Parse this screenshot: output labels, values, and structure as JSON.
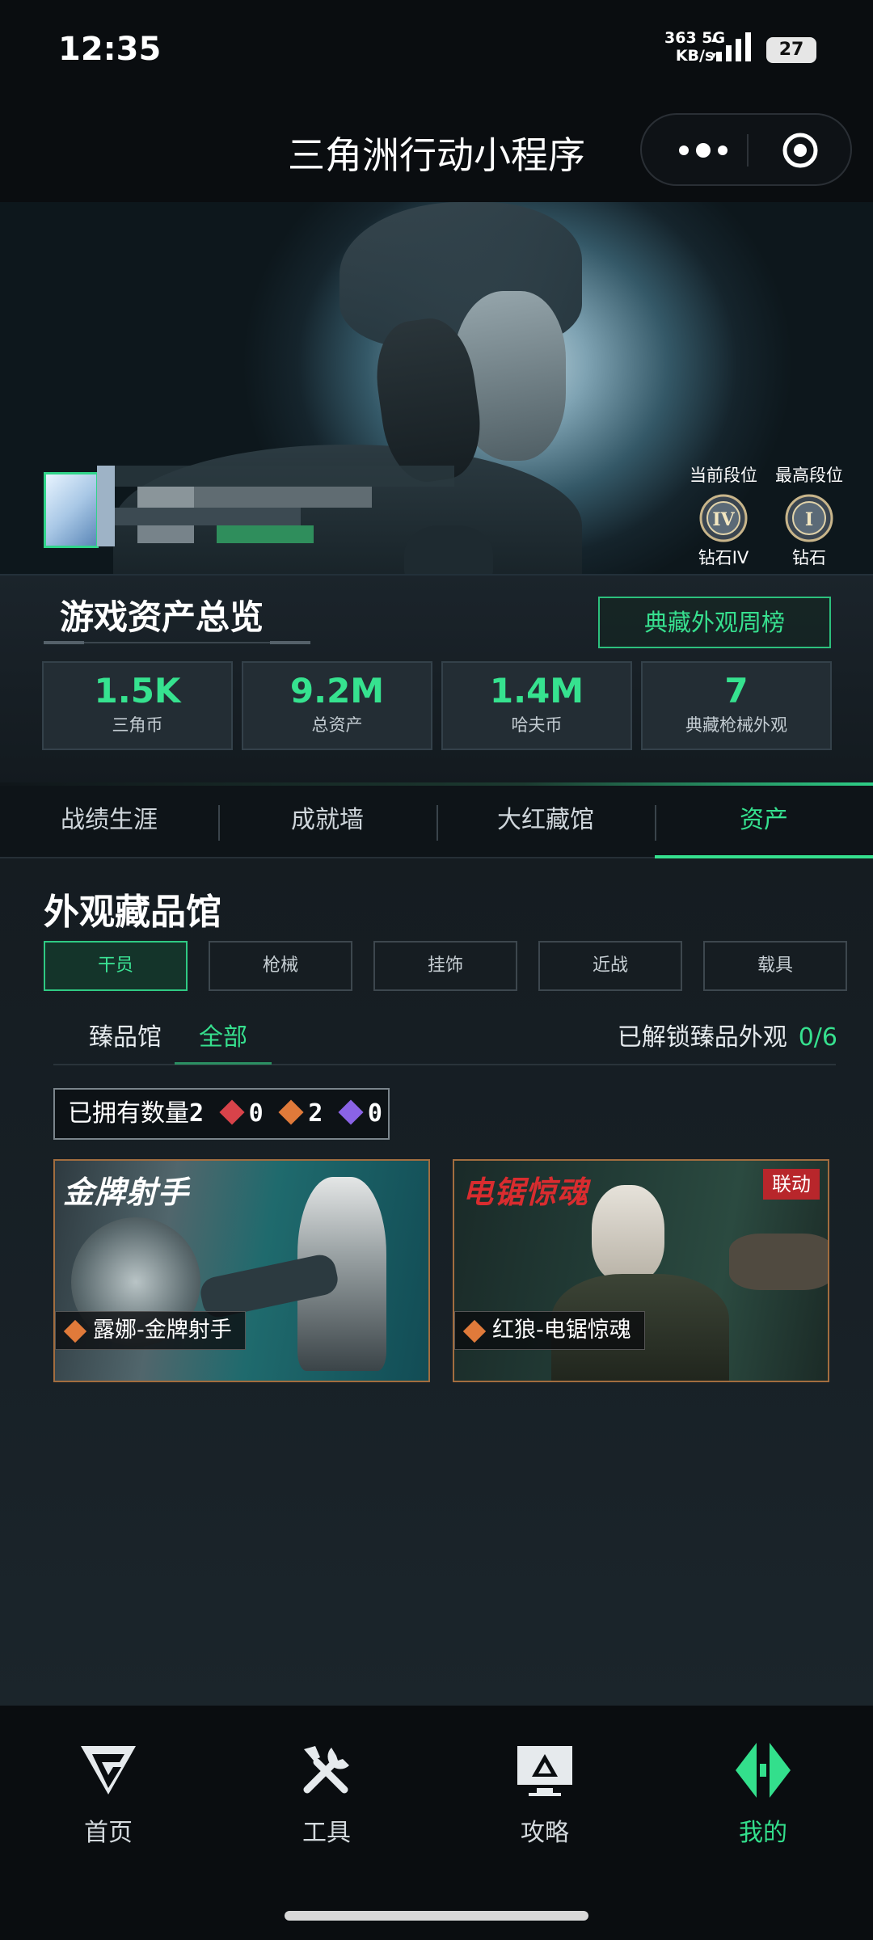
{
  "status_bar": {
    "time": "12:35",
    "net_speed": "363",
    "net_unit": "KB/s",
    "network": "5G",
    "battery": "27"
  },
  "header": {
    "title": "三角洲行动小程序"
  },
  "profile": {
    "current_rank_label": "当前段位",
    "current_rank": "钻石IV",
    "highest_rank_label": "最高段位",
    "highest_rank": "钻石",
    "current_rank_numeral": "IV",
    "highest_rank_numeral": "I"
  },
  "overview": {
    "title": "游戏资产总览",
    "weekly_button": "典藏外观周榜",
    "stats": [
      {
        "value": "1.5K",
        "label": "三角币"
      },
      {
        "value": "9.2M",
        "label": "总资产"
      },
      {
        "value": "1.4M",
        "label": "哈夫币"
      },
      {
        "value": "7",
        "label": "典藏枪械外观"
      }
    ]
  },
  "tabs": [
    "战绩生涯",
    "成就墙",
    "大红藏馆",
    "资产"
  ],
  "collection": {
    "title": "外观藏品馆",
    "categories": [
      "干员",
      "枪械",
      "挂饰",
      "近战",
      "载具"
    ],
    "subtabs": [
      "臻品馆",
      "全部"
    ],
    "unlocked_label": "已解锁臻品外观",
    "unlocked_value": "0/6",
    "owned_label": "已拥有数量",
    "owned_total": "2",
    "owned_red": "0",
    "owned_orange": "2",
    "owned_purple": "0",
    "colors": {
      "red": "#d8434a",
      "orange": "#e07a3a",
      "purple": "#8a63e6",
      "accent": "#36e08e"
    },
    "items": [
      {
        "name": "露娜-金牌射手",
        "logo": "金牌射手",
        "badge": ""
      },
      {
        "name": "红狼-电锯惊魂",
        "logo": "电锯惊魂",
        "badge": "联动"
      }
    ]
  },
  "bottom_nav": [
    {
      "label": "首页",
      "icon": "home-logo-icon"
    },
    {
      "label": "工具",
      "icon": "tools-icon"
    },
    {
      "label": "攻略",
      "icon": "guide-icon"
    },
    {
      "label": "我的",
      "icon": "profile-logo-icon"
    }
  ]
}
